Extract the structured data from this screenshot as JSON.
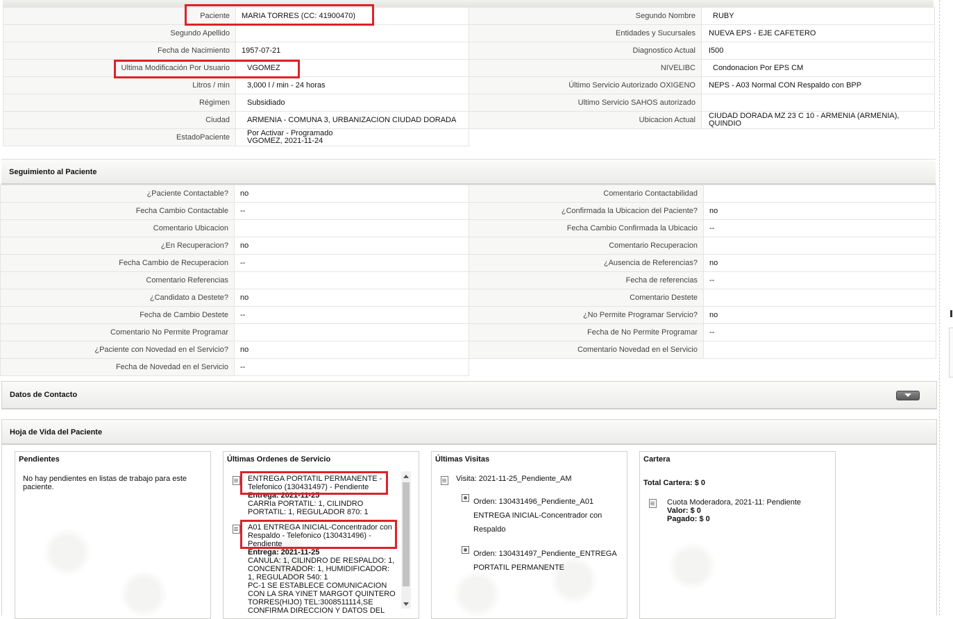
{
  "patient": {
    "left": [
      {
        "label": "Paciente",
        "value": "MARIA TORRES (CC: 41900470)"
      },
      {
        "label": "Segundo Apellido",
        "value": ""
      },
      {
        "label": "Fecha de Nacimiento",
        "value": "1957-07-21"
      },
      {
        "label": "Ultima Modificación Por Usuario",
        "value": "VGOMEZ"
      },
      {
        "label": "Litros / min",
        "value": "3,000 l / min - 24 horas"
      },
      {
        "label": "Régimen",
        "value": "Subsidiado"
      },
      {
        "label": "Ciudad",
        "value": "ARMENIA - COMUNA 3, URBANIZACION CIUDAD DORADA"
      },
      {
        "label": "EstadoPaciente",
        "value": "Por Activar - Programado\nVGOMEZ, 2021-11-24"
      }
    ],
    "right": [
      {
        "label": "Segundo Nombre",
        "value": "RUBY"
      },
      {
        "label": "Entidades y Sucursales",
        "value": "NUEVA EPS - EJE CAFETERO"
      },
      {
        "label": "Diagnostico Actual",
        "value": "I500"
      },
      {
        "label": "NIVELIBC",
        "value": "Condonacion Por EPS CM"
      },
      {
        "label": "Último Servicio Autorizado OXIGENO",
        "value": "NEPS - A03 Normal CON Respaldo con BPP"
      },
      {
        "label": "Ultimo Servicio SAHOS autorizado",
        "value": ""
      },
      {
        "label": "Ubicacion Actual",
        "value": "CIUDAD DORADA MZ 23 C 10 - ARMENIA (ARMENIA), QUINDIO"
      }
    ]
  },
  "seguimiento": {
    "title": "Seguimiento al Paciente",
    "left": [
      {
        "label": "¿Paciente Contactable?",
        "value": "no"
      },
      {
        "label": "Fecha Cambio Contactable",
        "value": "--"
      },
      {
        "label": "Comentario Ubicacion",
        "value": ""
      },
      {
        "label": "¿En Recuperacion?",
        "value": "no"
      },
      {
        "label": "Fecha Cambio de Recuperacion",
        "value": "--"
      },
      {
        "label": "Comentario Referencias",
        "value": ""
      },
      {
        "label": "¿Candidato a Destete?",
        "value": "no"
      },
      {
        "label": "Fecha de Cambio Destete",
        "value": "--"
      },
      {
        "label": "Comentario No Permite Programar",
        "value": ""
      },
      {
        "label": "¿Paciente con Novedad en el Servicio?",
        "value": "no"
      },
      {
        "label": "Fecha de Novedad en el Servicio",
        "value": "--"
      }
    ],
    "right": [
      {
        "label": "Comentario Contactabilidad",
        "value": ""
      },
      {
        "label": "¿Confirmada la Ubicacion del Paciente?",
        "value": "no"
      },
      {
        "label": "Fecha Cambio Confirmada la Ubicacio",
        "value": "--"
      },
      {
        "label": "Comentario Recuperacion",
        "value": ""
      },
      {
        "label": "¿Ausencia de Referencias?",
        "value": "no"
      },
      {
        "label": "Fecha de referencias",
        "value": "--"
      },
      {
        "label": "Comentario Destete",
        "value": ""
      },
      {
        "label": "¿No Permite Programar Servicio?",
        "value": "no"
      },
      {
        "label": "Fecha de No Permite Programar",
        "value": "--"
      },
      {
        "label": "Comentario Novedad en el Servicio",
        "value": ""
      }
    ]
  },
  "contacto": {
    "title": "Datos de Contacto",
    "toggle_icon": "chevron-down-icon"
  },
  "hoja": {
    "title": "Hoja de Vida del Paciente",
    "pendientes": {
      "title": "Pendientes",
      "empty_text": "No hay pendientes en listas de trabajo para este paciente."
    },
    "ordenes": {
      "title": "Últimas Ordenes de Servicio",
      "items": [
        {
          "name": "ENTREGA PORTATIL PERMANENTE - Telefonico (130431497) - Pendiente",
          "entrega": "Entrega: 2021-11-25",
          "details": "CARRIa PORTATIL: 1, CILINDRO PORTATIL: 1, REGULADOR 870: 1"
        },
        {
          "name": "A01 ENTREGA INICIAL-Concentrador con Respaldo - Telefonico (130431496) - Pendiente",
          "entrega": "Entrega: 2021-11-25",
          "details": "CANULA: 1, CILINDRO DE RESPALDO: 1, CONCENTRADOR: 1, HUMIDIFICADOR: 1, REGULADOR 540: 1",
          "comment": "PC-1 SE ESTABLECE COMUNICACION CON LA SRA YINET MARGOT QUINTERO TORRES(HIJO) TEL:3008511114,SE CONFIRMA DIRECCION Y DATOS DEL"
        }
      ]
    },
    "visitas": {
      "title": "Últimas Visitas",
      "visit": "Visita: 2021-11-25_Pendiente_AM",
      "orders": [
        "Orden: 130431496_Pendiente_A01 ENTREGA INICIAL-Concentrador con Respaldo",
        "Orden: 130431497_Pendiente_ENTREGA PORTATIL PERMANENTE"
      ]
    },
    "cartera": {
      "title": "Cartera",
      "total": "Total Cartera: $ 0",
      "item": "Cuota Moderadora, 2021-11: Pendiente",
      "valor": "Valor: $ 0",
      "pagado": "Pagado: $ 0"
    }
  },
  "colors": {
    "highlight": "#e0202a",
    "section_bg": "#ececea"
  }
}
